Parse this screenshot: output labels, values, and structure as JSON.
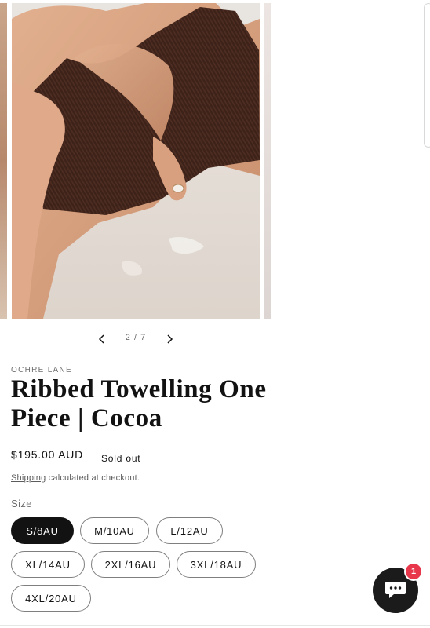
{
  "gallery": {
    "counter": "2 / 7",
    "prev_icon": "chevron-left-icon",
    "next_icon": "chevron-right-icon"
  },
  "product": {
    "vendor": "OCHRE LANE",
    "title": "Ribbed Towelling One Piece | Cocoa",
    "price": "$195.00 AUD",
    "badge": "Sold out",
    "shipping_link": "Shipping",
    "shipping_suffix": " calculated at checkout."
  },
  "size": {
    "label": "Size",
    "selected": "S/8AU",
    "options": [
      "S/8AU",
      "M/10AU",
      "L/12AU",
      "XL/14AU",
      "2XL/16AU",
      "3XL/18AU",
      "4XL/20AU"
    ]
  },
  "chat": {
    "icon": "chat-bubble-icon",
    "badge_count": "1"
  },
  "colors": {
    "text": "#121212",
    "selected_pill": "#121212",
    "badge": "#e8364a",
    "chat_button": "#1b1b1b"
  }
}
